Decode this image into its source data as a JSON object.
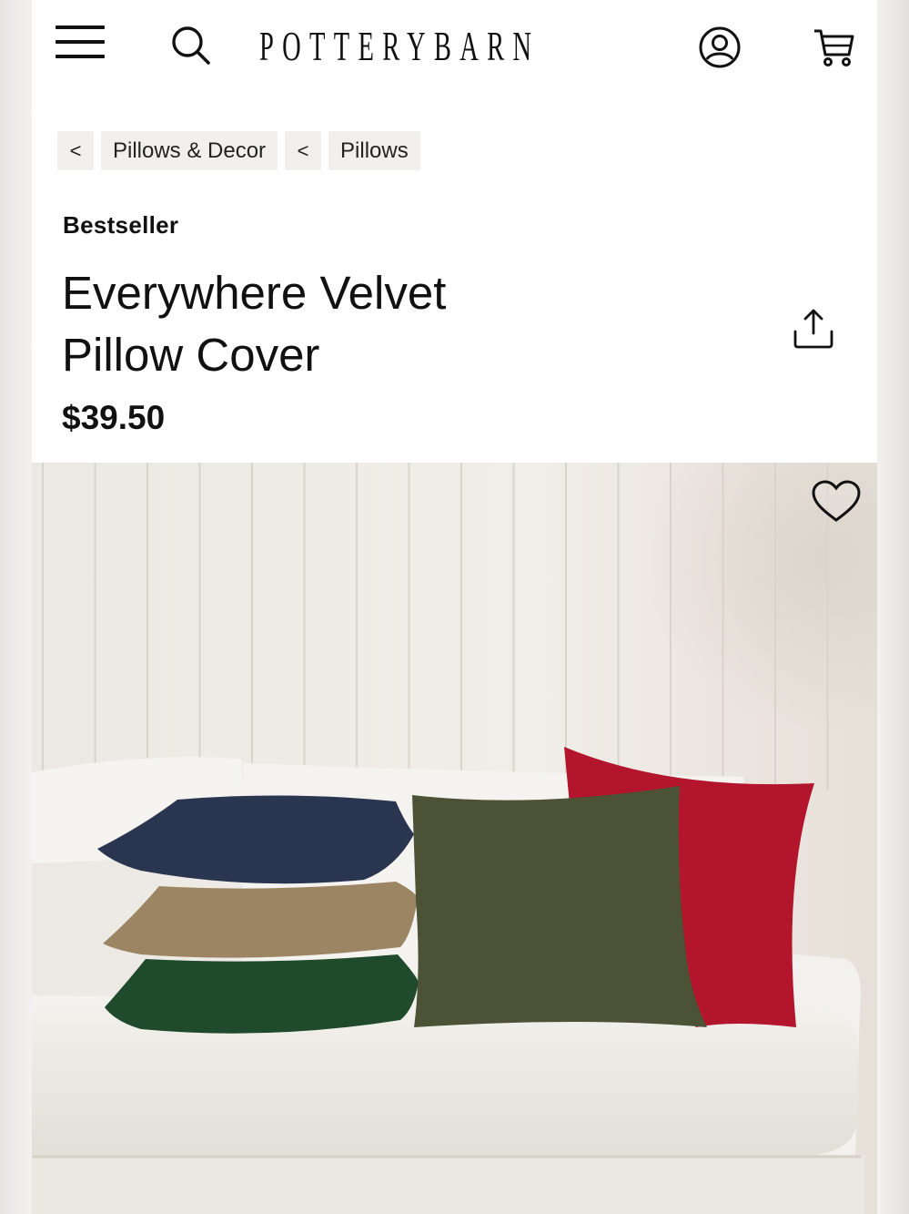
{
  "header": {
    "brand": "POTTERYBARN",
    "menu_icon": "hamburger-menu-icon",
    "search_icon": "search-icon",
    "account_icon": "account-icon",
    "cart_icon": "cart-icon"
  },
  "breadcrumb": {
    "items": [
      {
        "chevron": "<",
        "label": "Pillows & Decor"
      },
      {
        "chevron": "<",
        "label": "Pillows"
      }
    ]
  },
  "product": {
    "badge": "Bestseller",
    "title": "Everywhere Velvet Pillow Cover",
    "price": "$39.50",
    "share_icon": "share-icon",
    "favorite_icon": "heart-icon"
  },
  "colors": {
    "navy": "#2a3550",
    "taupe": "#9c8563",
    "forest": "#1f4a2c",
    "olive": "#4b5236",
    "crimson": "#b3152c"
  }
}
